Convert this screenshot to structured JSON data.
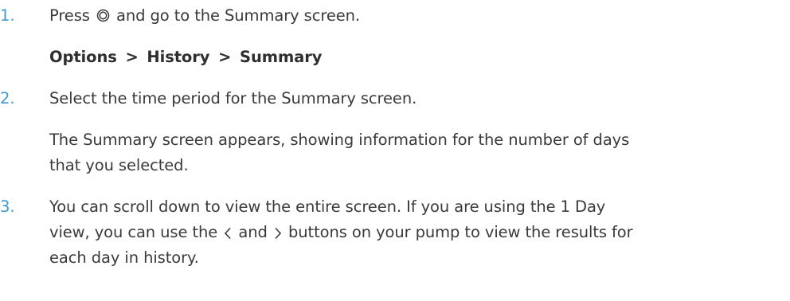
{
  "steps": [
    {
      "number": "1.",
      "text_before": "Press",
      "icon": "select-button-icon",
      "text_after": "and go to the Summary screen.",
      "path": [
        "Options",
        "History",
        "Summary"
      ],
      "path_separator": ">"
    },
    {
      "number": "2.",
      "text": "Select the time period for the Summary screen.",
      "result_line1": "The Summary screen appears, showing information for the number of days",
      "result_line2": "that you selected."
    },
    {
      "number": "3.",
      "line1": "You can scroll down to view the entire screen. If you are using the 1 Day",
      "line2_before": "view, you can use the",
      "left_icon": "chevron-left-icon",
      "line2_middle": "and",
      "right_icon": "chevron-right-icon",
      "line2_after": "buttons on your pump to view the results for",
      "line3": "each day in history."
    }
  ],
  "colors": {
    "step_number": "#3d9ad1",
    "body_text": "#3a3a3a",
    "bold_text": "#2f2f2f"
  }
}
